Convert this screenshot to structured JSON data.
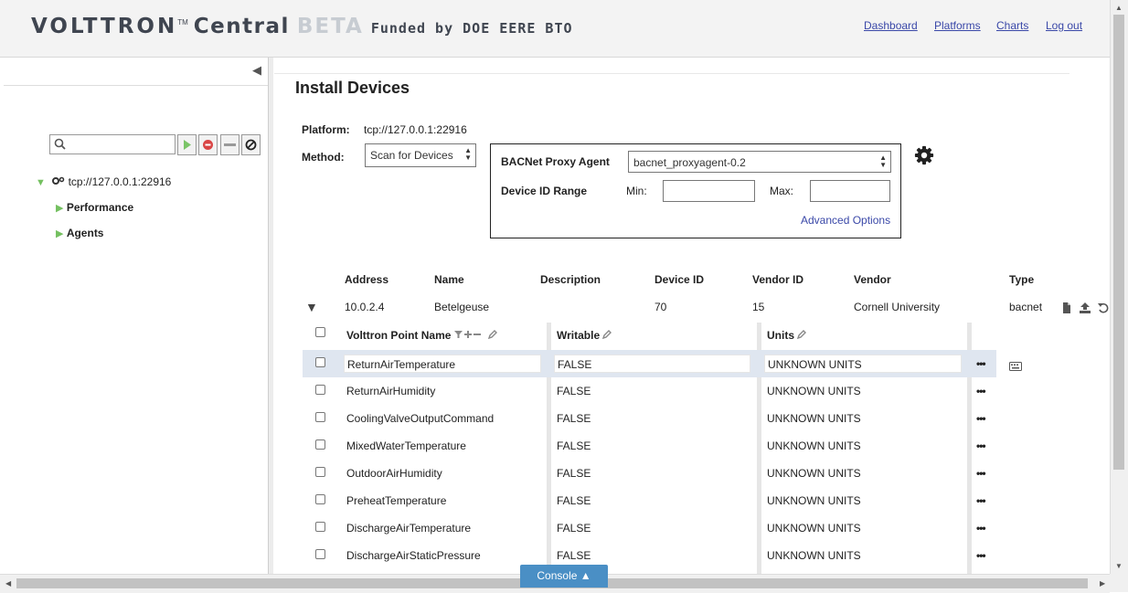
{
  "header": {
    "logo_volttron": "VOLTTRON",
    "logo_tm": "TM",
    "logo_central": "Central",
    "logo_beta": "BETA",
    "logo_funded": "Funded by DOE EERE BTO",
    "nav": [
      "Dashboard",
      "Platforms",
      "Charts",
      "Log out"
    ]
  },
  "sidebar": {
    "platform": "tcp://127.0.0.1:22916",
    "items": [
      "Performance",
      "Agents"
    ]
  },
  "main": {
    "title": "Install Devices",
    "platform_label": "Platform:",
    "platform_value": "tcp://127.0.0.1:22916",
    "method_label": "Method:",
    "method_value": "Scan for Devices",
    "proxy_label": "BACNet Proxy Agent",
    "proxy_value": "bacnet_proxyagent-0.2",
    "range_label": "Device ID Range",
    "min_label": "Min:",
    "max_label": "Max:",
    "advanced": "Advanced Options"
  },
  "device_table": {
    "headers": [
      "Address",
      "Name",
      "Description",
      "Device ID",
      "Vendor ID",
      "Vendor",
      "Type"
    ],
    "row": {
      "address": "10.0.2.4",
      "name": "Betelgeuse",
      "description": "",
      "device_id": "70",
      "vendor_id": "15",
      "vendor": "Cornell University",
      "type": "bacnet"
    }
  },
  "points_table": {
    "headers": [
      "Volttron Point Name",
      "Writable",
      "Units"
    ],
    "rows": [
      {
        "name": "ReturnAirTemperature",
        "writable": "FALSE",
        "units": "UNKNOWN UNITS"
      },
      {
        "name": "ReturnAirHumidity",
        "writable": "FALSE",
        "units": "UNKNOWN UNITS"
      },
      {
        "name": "CoolingValveOutputCommand",
        "writable": "FALSE",
        "units": "UNKNOWN UNITS"
      },
      {
        "name": "MixedWaterTemperature",
        "writable": "FALSE",
        "units": "UNKNOWN UNITS"
      },
      {
        "name": "OutdoorAirHumidity",
        "writable": "FALSE",
        "units": "UNKNOWN UNITS"
      },
      {
        "name": "PreheatTemperature",
        "writable": "FALSE",
        "units": "UNKNOWN UNITS"
      },
      {
        "name": "DischargeAirTemperature",
        "writable": "FALSE",
        "units": "UNKNOWN UNITS"
      },
      {
        "name": "DischargeAirStaticPressure",
        "writable": "FALSE",
        "units": "UNKNOWN UNITS"
      }
    ],
    "row_menu": "•••"
  },
  "console": {
    "label": "Console ▲"
  },
  "colors": {
    "link": "#3a48a8",
    "tree_arrow": "#74c060",
    "console": "#4a8fc5",
    "row_highlight": "#dfe6f0"
  },
  "icons": [
    "search-icon",
    "play-icon",
    "stop-icon",
    "minus-icon",
    "cancel-icon",
    "gear-icon",
    "file-icon",
    "upload-icon",
    "undo-icon",
    "keyboard-icon",
    "filter-icon",
    "plus-icon",
    "pencil-icon"
  ]
}
